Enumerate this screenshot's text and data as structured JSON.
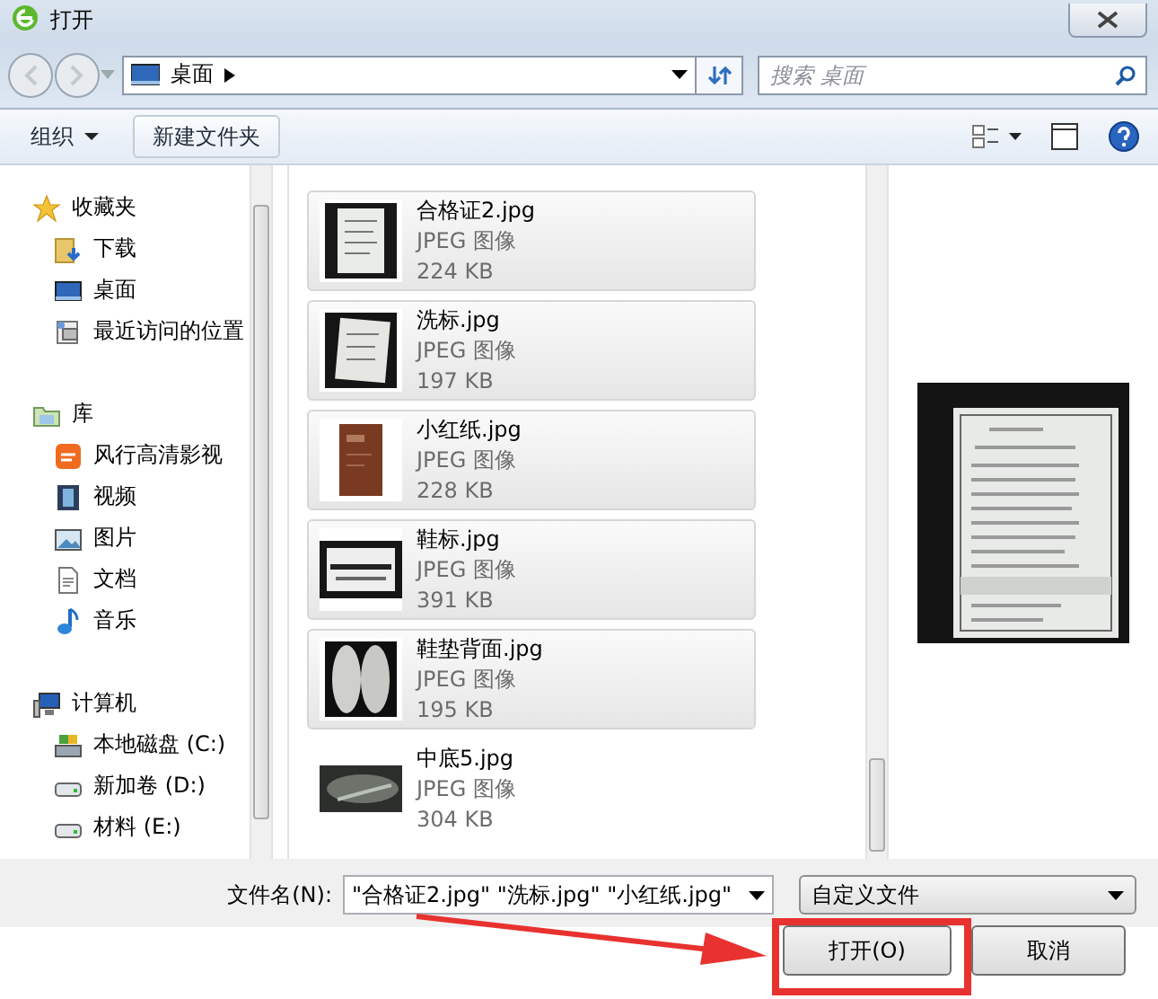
{
  "window": {
    "title": "打开"
  },
  "address": {
    "path": "桌面"
  },
  "search": {
    "placeholder": "搜索 桌面"
  },
  "toolbar": {
    "organize": "组织",
    "new_folder": "新建文件夹"
  },
  "navigation": [
    {
      "label": "收藏夹",
      "children": [
        {
          "label": "下载"
        },
        {
          "label": "桌面"
        },
        {
          "label": "最近访问的位置"
        }
      ]
    },
    {
      "label": "库",
      "children": [
        {
          "label": "风行高清影视"
        },
        {
          "label": "视频"
        },
        {
          "label": "图片"
        },
        {
          "label": "文档"
        },
        {
          "label": "音乐"
        }
      ]
    },
    {
      "label": "计算机",
      "children": [
        {
          "label": "本地磁盘 (C:)"
        },
        {
          "label": "新加卷 (D:)"
        },
        {
          "label": "材料 (E:)"
        }
      ]
    }
  ],
  "files": [
    {
      "name": "合格证2.jpg",
      "type": "JPEG 图像",
      "size": "224 KB",
      "selected": true
    },
    {
      "name": "洗标.jpg",
      "type": "JPEG 图像",
      "size": "197 KB",
      "selected": true
    },
    {
      "name": "小红纸.jpg",
      "type": "JPEG 图像",
      "size": "228 KB",
      "selected": true
    },
    {
      "name": "鞋标.jpg",
      "type": "JPEG 图像",
      "size": "391 KB",
      "selected": true
    },
    {
      "name": "鞋垫背面.jpg",
      "type": "JPEG 图像",
      "size": "195 KB",
      "selected": true
    },
    {
      "name": "中底5.jpg",
      "type": "JPEG 图像",
      "size": "304 KB",
      "selected": false
    }
  ],
  "footer": {
    "filename_label": "文件名(N):",
    "filename_value": "\"合格证2.jpg\" \"洗标.jpg\" \"小红纸.jpg\"",
    "file_type": "自定义文件",
    "buttons": [
      "打开(O)",
      "取消"
    ]
  }
}
